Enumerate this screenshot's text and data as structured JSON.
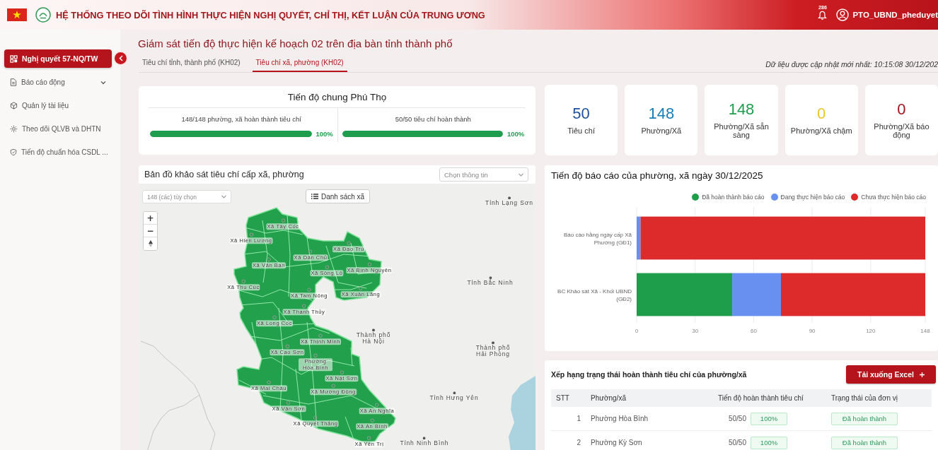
{
  "header": {
    "title": "HỆ THỐNG THEO DÕI TÌNH HÌNH THỰC HIỆN NGHỊ QUYẾT, CHỈ THỊ, KẾT LUẬN CỦA TRUNG ƯƠNG",
    "notification_count": "286",
    "user_name": "PTO_UBND_pheduyet"
  },
  "sidebar": {
    "items": [
      {
        "label": "Nghị quyết 57-NQ/TW",
        "selected": true,
        "kind": "link"
      },
      {
        "label": "Báo cáo động",
        "selected": false,
        "kind": "group"
      },
      {
        "label": "Quản lý tài liệu",
        "selected": false,
        "kind": "link"
      },
      {
        "label": "Theo dõi QLVB và DHTN",
        "selected": false,
        "kind": "link"
      },
      {
        "label": "Tiến độ chuẩn hóa CSDL ...",
        "selected": false,
        "kind": "link"
      }
    ]
  },
  "page": {
    "title": "Giám sát tiến độ thực hiện kế hoạch 02 trên địa bàn tỉnh thành phố",
    "tabs": [
      {
        "label": "Tiêu chí tỉnh, thành phố (KH02)",
        "selected": false
      },
      {
        "label": "Tiêu chí xã, phường (KH02)",
        "selected": true
      }
    ],
    "updated": "Dữ liệu được cập nhật mới nhất: 10:15:08 30/12/202"
  },
  "overall_progress": {
    "title": "Tiến độ chung Phú Thọ",
    "items": [
      {
        "label": "148/148 phường, xã hoàn thành tiêu chí",
        "level": 1,
        "reading": "100%"
      },
      {
        "label": "50/50 tiêu chí hoàn thành",
        "level": 1,
        "reading": "100%"
      }
    ]
  },
  "stats": [
    {
      "value": "50",
      "label": "Tiêu chí",
      "color": "#1f4e9c"
    },
    {
      "value": "148",
      "label": "Phường/Xã",
      "color": "#1a7db5"
    },
    {
      "value": "148",
      "label": "Phường/Xã sẵn sàng",
      "color": "#1e9e4e"
    },
    {
      "value": "0",
      "label": "Phường/Xã chậm",
      "color": "#eec52a"
    },
    {
      "value": "0",
      "label": "Phường/Xã báo động",
      "color": "#a3141c"
    }
  ],
  "map": {
    "title": "Bản đồ khảo sát tiêu chí cấp xã, phường",
    "info_select": {
      "placeholder": "Chọn thông tin"
    },
    "commune_select": {
      "value": "148 (các) tùy chọn"
    },
    "list_button": "Danh sách xã",
    "zoom_in": "+",
    "zoom_out": "−",
    "places": [
      {
        "name": "Tỉnh Lạng Sơn",
        "kind": "province"
      },
      {
        "name": "Xã Tây Cốc",
        "kind": "commune"
      },
      {
        "name": "Xã Hiền Lương",
        "kind": "commune"
      },
      {
        "name": "Xã Đạo Trù",
        "kind": "commune"
      },
      {
        "name": "Xã Dân Chủ",
        "kind": "commune"
      },
      {
        "name": "Xã Văn Bán",
        "kind": "commune"
      },
      {
        "name": "Xã Sông Lô",
        "kind": "commune"
      },
      {
        "name": "Xã Bình Nguyên",
        "kind": "commune"
      },
      {
        "name": "Xã Thu Cúc",
        "kind": "commune"
      },
      {
        "name": "Tỉnh Bắc Ninh",
        "kind": "province"
      },
      {
        "name": "Xã Tam Nông",
        "kind": "commune"
      },
      {
        "name": "Xã Xuân Lãng",
        "kind": "commune"
      },
      {
        "name": "Xã Thanh Thủy",
        "kind": "commune"
      },
      {
        "name": "Xã Long Cốc",
        "kind": "commune"
      },
      {
        "name": "Xã Thịnh Minh",
        "kind": "commune"
      },
      {
        "name": "Thành phố Hà Nội",
        "kind": "city"
      },
      {
        "name": "Xã Cao Sơn",
        "kind": "commune"
      },
      {
        "name": "Thành phố Hải Phòng",
        "kind": "city"
      },
      {
        "name": "Phường Hòa Bình",
        "kind": "ward"
      },
      {
        "name": "Xã Nật Sơn",
        "kind": "commune"
      },
      {
        "name": "Xã Mai Châu",
        "kind": "commune"
      },
      {
        "name": "Xã Mường Động",
        "kind": "commune"
      },
      {
        "name": "Tỉnh Hưng Yên",
        "kind": "province"
      },
      {
        "name": "Xã Vân Sơn",
        "kind": "commune"
      },
      {
        "name": "Xã An Nghĩa",
        "kind": "commune"
      },
      {
        "name": "Xã Quyết Thắng",
        "kind": "commune"
      },
      {
        "name": "Xã An Bình",
        "kind": "commune"
      },
      {
        "name": "Xã Yên Trị",
        "kind": "commune"
      },
      {
        "name": "Tỉnh Ninh Bình",
        "kind": "province"
      }
    ]
  },
  "report_chart": {
    "title": "Tiến độ báo cáo của phường, xã ngày 30/12/2025",
    "chart_data": {
      "type": "bar",
      "orientation": "horizontal",
      "stacked": true,
      "grid": true,
      "legend": true,
      "categories": [
        "Báo cáo hằng ngày cấp Xã Phường (GĐ1)",
        "BC Khảo sát Xã - Khối UBND (GĐ2)"
      ],
      "series": [
        {
          "name": "Đã hoàn thành báo cáo",
          "color": "#1e9e4a",
          "values": [
            0,
            49
          ]
        },
        {
          "name": "Đang thực hiện báo cáo",
          "color": "#6790f0",
          "values": [
            2,
            25
          ]
        },
        {
          "name": "Chưa thực hiện báo cáo",
          "color": "#dd2a2a",
          "values": [
            146,
            74
          ]
        }
      ],
      "xlim": [
        0,
        148
      ],
      "xticks": [
        0,
        30,
        60,
        90,
        120,
        148
      ]
    }
  },
  "ranking": {
    "title": "Xếp hạng trạng thái hoàn thành tiêu chí của phường/xã",
    "download_button": "Tải xuống Excel",
    "columns": [
      "STT",
      "Phường/xã",
      "Tiến độ hoàn thành tiêu chí",
      "Trạng thái của đơn vị"
    ],
    "rows": [
      {
        "stt": "1",
        "name": "Phường Hòa Bình",
        "score": "50/50",
        "percent": "100%",
        "status": "Đã hoàn thành"
      },
      {
        "stt": "2",
        "name": "Phường Kỳ Sơn",
        "score": "50/50",
        "percent": "100%",
        "status": "Đã hoàn thành"
      }
    ]
  }
}
